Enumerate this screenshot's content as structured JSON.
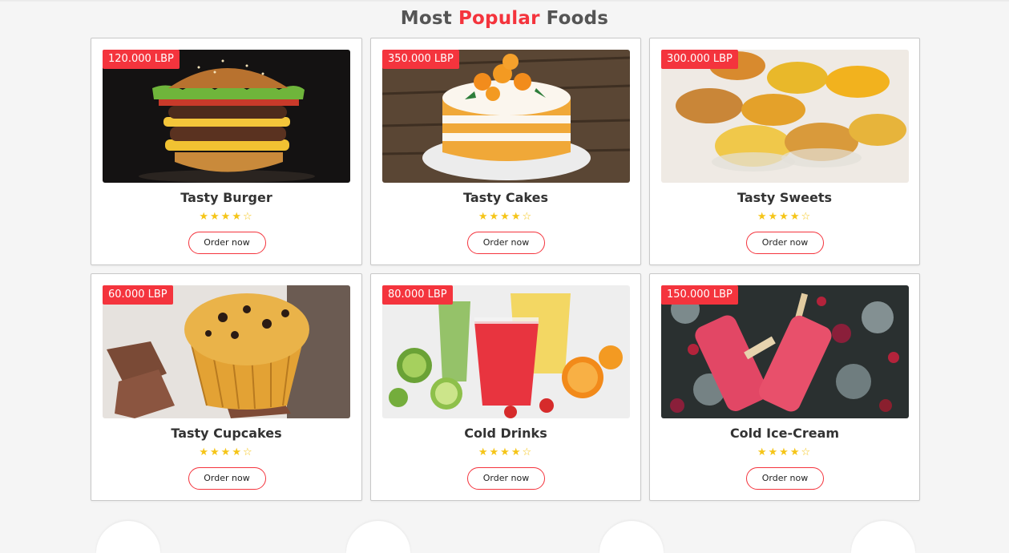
{
  "section": {
    "title_part1": "Most",
    "title_part2": "Popular",
    "title_part3": "Foods"
  },
  "cards": [
    {
      "price": "120.000 LBP",
      "title": "Tasty Burger",
      "rating": 4,
      "button": "Order now"
    },
    {
      "price": "350.000 LBP",
      "title": "Tasty Cakes",
      "rating": 4,
      "button": "Order now"
    },
    {
      "price": "300.000 LBP",
      "title": "Tasty Sweets",
      "rating": 4,
      "button": "Order now"
    },
    {
      "price": "60.000 LBP",
      "title": "Tasty Cupcakes",
      "rating": 4,
      "button": "Order now"
    },
    {
      "price": "80.000 LBP",
      "title": "Cold Drinks",
      "rating": 4,
      "button": "Order now"
    },
    {
      "price": "150.000 LBP",
      "title": "Cold Ice-Cream",
      "rating": 4,
      "button": "Order now"
    }
  ],
  "colors": {
    "accent": "#f4343d",
    "star": "#f5c518"
  }
}
